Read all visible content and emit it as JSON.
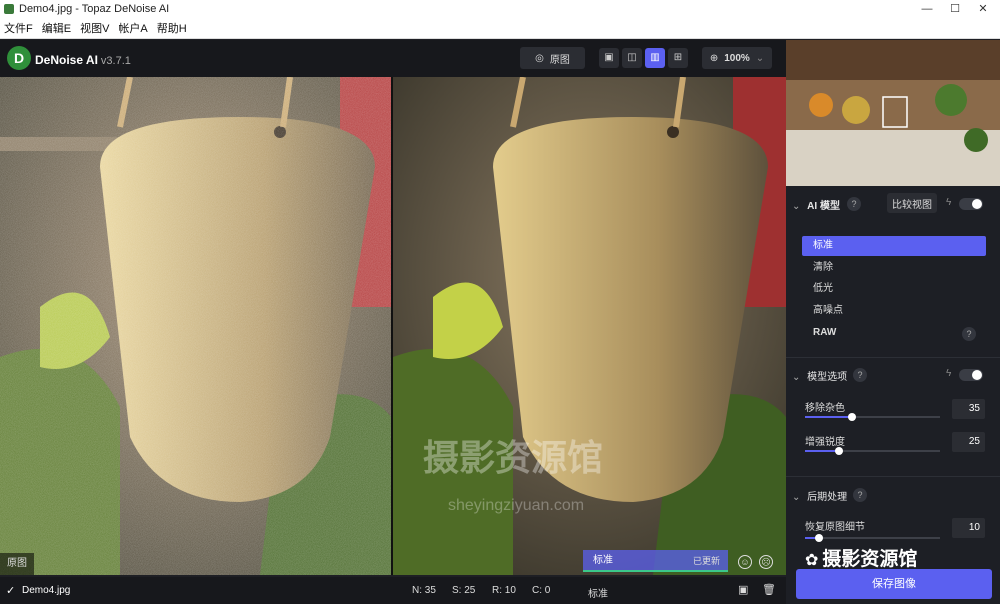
{
  "window": {
    "title": "Demo4.jpg - Topaz DeNoise AI",
    "minimize": "—",
    "maximize": "☐",
    "close": "✕"
  },
  "menu": [
    "文件F",
    "编辑E",
    "视图V",
    "帐户A",
    "帮助H"
  ],
  "toolbar": {
    "app_name": "DeNoise AI",
    "version": "v3.7.1",
    "original_label": "原图",
    "zoom": "100%"
  },
  "left_pane_label": "原图",
  "right_pane": {
    "model_label": "标准",
    "updated_label": "已更新"
  },
  "bottom": {
    "filename": "Demo4.jpg",
    "n": "N: 35",
    "s": "S: 25",
    "r": "R: 10",
    "c": "C: 0",
    "model": "标准"
  },
  "sidebar": {
    "ai_model": {
      "title": "AI 模型",
      "compare_view": "比较视图"
    },
    "models": [
      "标准",
      "清除",
      "低光",
      "高噪点",
      "RAW"
    ],
    "model_options": {
      "title": "模型选项"
    },
    "sliders": [
      {
        "label": "移除杂色",
        "value": "35"
      },
      {
        "label": "增强锐度",
        "value": "25"
      }
    ],
    "post": {
      "title": "后期处理",
      "slider_label": "恢复原图细节",
      "value": "10"
    },
    "save": "保存图像"
  },
  "watermark": {
    "text": "摄影资源馆",
    "sub": "sheyingziyuan.com"
  },
  "colors": {
    "accent": "#5b60f0",
    "bg": "#1d1f25"
  }
}
